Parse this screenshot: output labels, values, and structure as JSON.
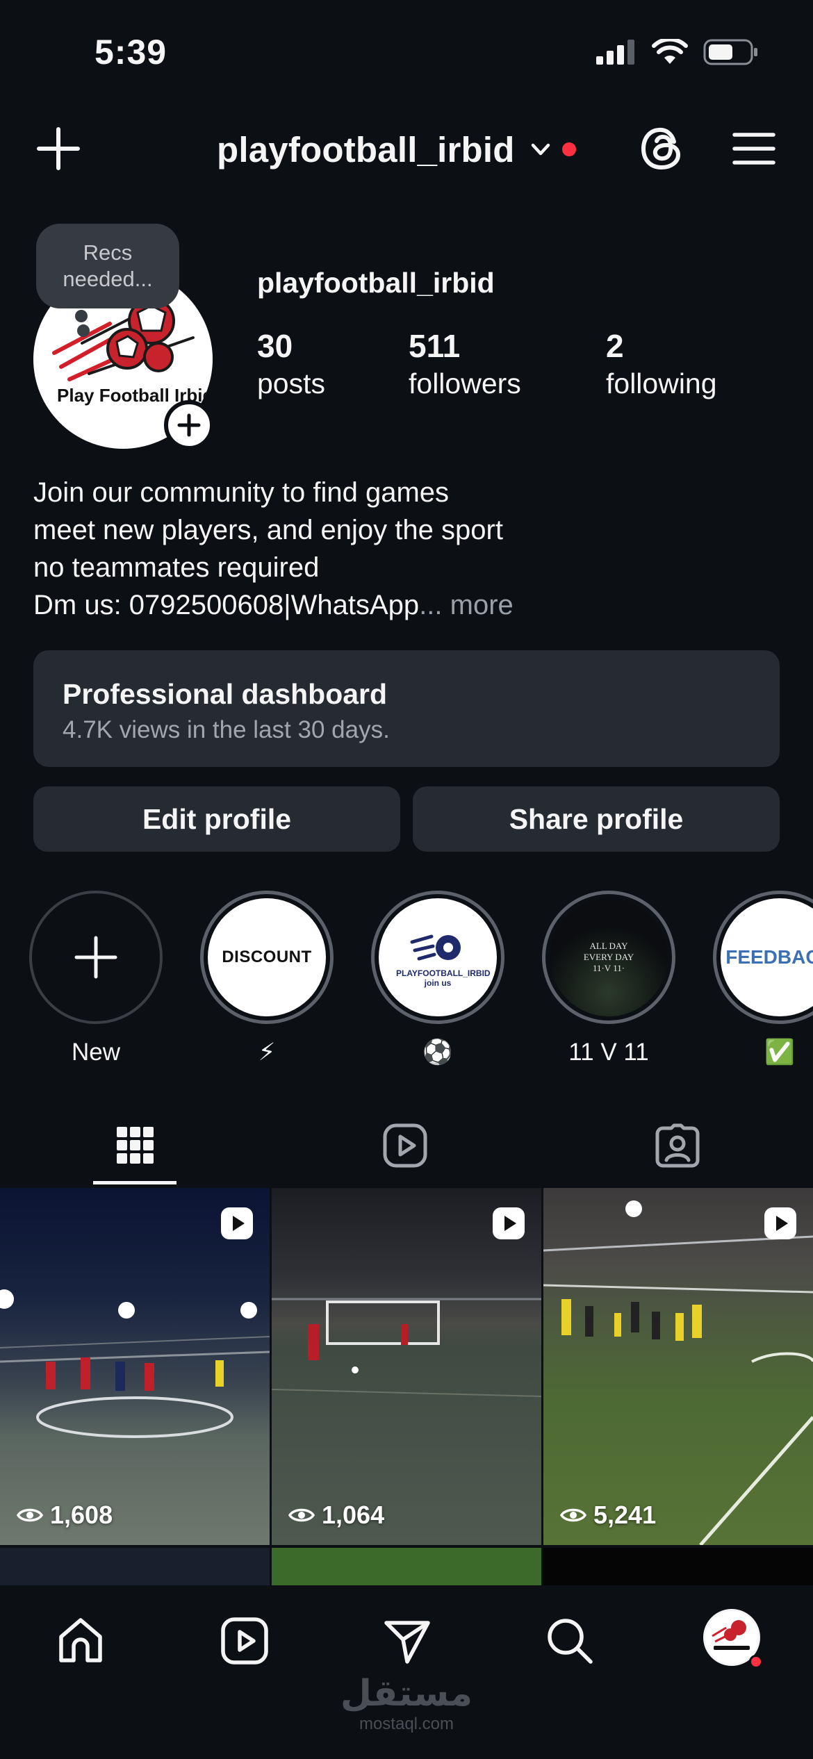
{
  "status_bar": {
    "time": "5:39"
  },
  "header": {
    "title": "playfootball_irbid"
  },
  "profile": {
    "note": "Recs needed...",
    "username": "playfootball_irbid",
    "avatar_logo_text": "Play Football Irbid",
    "stats": {
      "posts": {
        "value": "30",
        "label": "posts"
      },
      "followers": {
        "value": "511",
        "label": "followers"
      },
      "following": {
        "value": "2",
        "label": "following"
      }
    },
    "bio": [
      "Join our community to find games",
      "meet new players, and enjoy the sport",
      "no teammates required",
      "Dm us: 0792500608|WhatsApp"
    ],
    "bio_more": "... more"
  },
  "dashboard": {
    "title": "Professional dashboard",
    "subtitle": "4.7K views in the last 30 days."
  },
  "buttons": {
    "edit": "Edit profile",
    "share": "Share profile"
  },
  "highlights": [
    {
      "label": "New",
      "cover": ""
    },
    {
      "label": "⚡",
      "cover": "DISCOUNT"
    },
    {
      "label": "⚽",
      "cover": "PLAYFOOTBALL_IRBID join us"
    },
    {
      "label": "11 V 11",
      "cover": "ALL DAY EVERY DAY 11·V 11·"
    },
    {
      "label": "✅",
      "cover": "FEEDBACK"
    }
  ],
  "tabs": [
    "grid-icon",
    "reels-icon",
    "tagged-icon"
  ],
  "posts": [
    {
      "views": "1,608"
    },
    {
      "views": "1,064"
    },
    {
      "views": "5,241"
    }
  ],
  "watermark": {
    "arabic": "مستقل",
    "latin": "mostaql.com"
  },
  "colors": {
    "background": "#0c0f14",
    "card": "#262a31",
    "notification": "#ff3040",
    "muted": "#9aa0a8"
  }
}
